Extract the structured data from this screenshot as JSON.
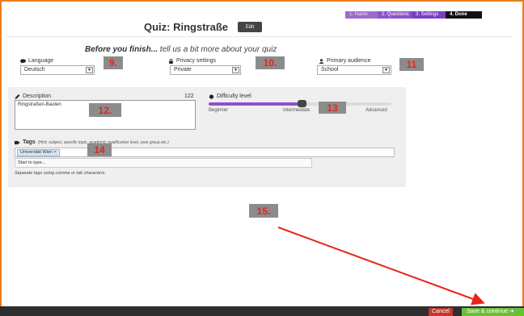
{
  "steps": [
    {
      "label": "1. Name"
    },
    {
      "label": "2. Questions"
    },
    {
      "label": "3. Settings"
    },
    {
      "label": "4. Done"
    }
  ],
  "quiz": {
    "title": "Quiz: Ringstraße",
    "edit_label": "Edit"
  },
  "intro": {
    "lead": "Before you finish...",
    "rest": " tell us a bit more about your quiz"
  },
  "language": {
    "label": "Language",
    "value": "Deutsch",
    "icon": "speech-bubble-icon"
  },
  "privacy": {
    "label": "Privacy settings",
    "value": "Private",
    "icon": "lock-icon"
  },
  "audience": {
    "label": "Primary audience",
    "value": "School",
    "icon": "person-icon"
  },
  "description": {
    "label": "Description",
    "value": "Ringstraßen-Bauten",
    "counter": "122",
    "icon": "pencil-icon"
  },
  "difficulty": {
    "label": "Difficulty level",
    "level": 0.51,
    "labels": {
      "low": "Beginner",
      "mid": "Intermediate",
      "high": "Advanced"
    },
    "icon": "circle-icon"
  },
  "tags": {
    "label": "Tags",
    "hint": "(Hint: subject, specific topic, academic qualification level, year group etc.)",
    "chips": [
      "Universität Wien ×"
    ],
    "dropdown_text": "Start to type...",
    "help": "Separate tags using comma or tab characters.",
    "icon": "tags-icon"
  },
  "annotations": [
    "9.",
    "10.",
    "11",
    "12.",
    "13",
    "14",
    "15."
  ],
  "footer": {
    "cancel_label": "Cancel",
    "save_label": "Save & continue ➔"
  },
  "colors": {
    "accent_purple": "#8e52cc",
    "frame_orange": "#e87d1e",
    "annotation_red": "#e8231a",
    "cancel_red": "#c0392b",
    "save_green": "#6cbf38"
  }
}
